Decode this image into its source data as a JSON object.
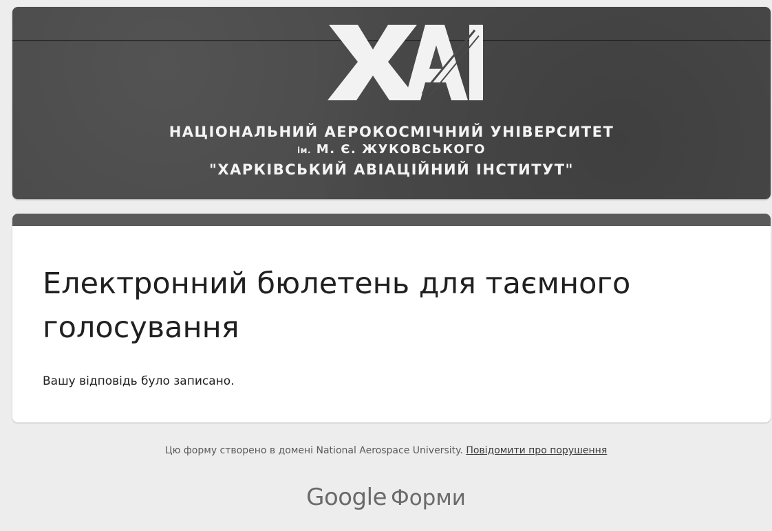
{
  "header": {
    "logo_text": "ХАІ",
    "university_line1": "НАЦІОНАЛЬНИЙ АЕРОКОСМІЧНИЙ УНІВЕРСИТЕТ",
    "university_line2_prefix": "ім.",
    "university_line2": "М. Є. ЖУКОВСЬКОГО",
    "university_line3": "\"ХАРКІВСЬКИЙ АВІАЦІЙНИЙ ІНСТИТУТ\""
  },
  "form": {
    "title": "Електронний бюлетень для таємного голосування",
    "confirmation": "Вашу відповідь було записано."
  },
  "footer": {
    "note": "Цю форму створено в домені National Aerospace University.",
    "report_link": "Повідомити про порушення",
    "brand_google": "Google",
    "brand_forms": "Форми"
  },
  "colors": {
    "banner": "#4a4a4a",
    "accent": "#5a5a5a",
    "background": "#ededed"
  }
}
